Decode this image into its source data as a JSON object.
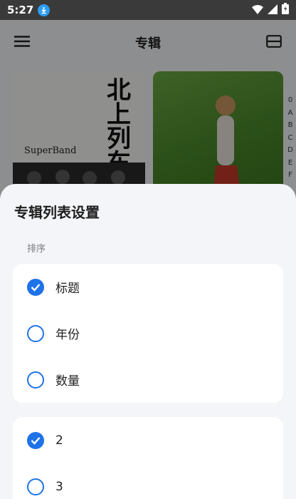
{
  "status_bar": {
    "time": "5:27"
  },
  "app_bar": {
    "title": "专辑"
  },
  "albums": [
    {
      "title_art": "北上列车",
      "band_text": "SuperBand"
    },
    {
      "title_art": ""
    }
  ],
  "index_letters": [
    "0",
    "A",
    "B",
    "C",
    "D",
    "E",
    "F"
  ],
  "sheet": {
    "title": "专辑列表设置",
    "sort_label": "排序",
    "sort_options": [
      {
        "label": "标题",
        "checked": true
      },
      {
        "label": "年份",
        "checked": false
      },
      {
        "label": "数量",
        "checked": false
      }
    ],
    "column_options": [
      {
        "label": "2",
        "checked": true
      },
      {
        "label": "3",
        "checked": false
      }
    ]
  },
  "colors": {
    "accent": "#1f73e8",
    "status_bar": "#3a3a3a",
    "sheet_bg": "#f4f5f8"
  }
}
